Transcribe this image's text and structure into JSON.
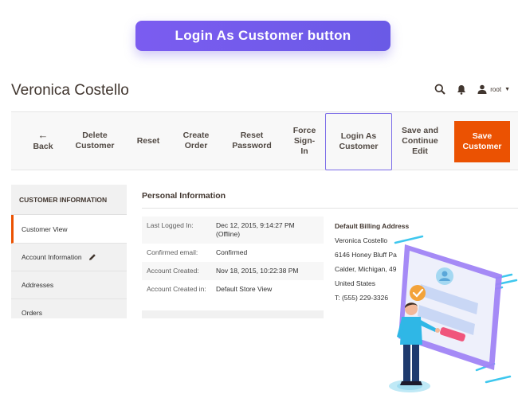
{
  "banner": {
    "label": "Login As Customer button"
  },
  "header": {
    "customer_name": "Veronica Costello",
    "user_label": "root"
  },
  "toolbar": {
    "back": "Back",
    "delete_customer": "Delete\nCustomer",
    "reset": "Reset",
    "create_order": "Create\nOrder",
    "reset_password": "Reset\nPassword",
    "force_sign_in": "Force\nSign-\nIn",
    "login_as_customer": "Login As\nCustomer",
    "save_and_continue": "Save and\nContinue\nEdit",
    "save_customer": "Save\nCustomer"
  },
  "sidebar": {
    "title": "CUSTOMER INFORMATION",
    "items": [
      {
        "label": "Customer View"
      },
      {
        "label": "Account Information"
      },
      {
        "label": "Addresses"
      },
      {
        "label": "Orders"
      }
    ]
  },
  "personal_info": {
    "title": "Personal Information",
    "rows": [
      {
        "label": "Last Logged In:",
        "value": "Dec 12, 2015, 9:14:27 PM (Offline)"
      },
      {
        "label": "Confirmed email:",
        "value": "Confirmed"
      },
      {
        "label": "Account Created:",
        "value": "Nov 18, 2015, 10:22:38 PM"
      },
      {
        "label": "Account Created in:",
        "value": "Default Store View"
      }
    ]
  },
  "billing": {
    "title": "Default Billing Address",
    "lines": [
      "Veronica Costello",
      "6146 Honey Bluff Pa",
      "Calder, Michigan, 49",
      "United States",
      "T: (555) 229-3326"
    ]
  },
  "colors": {
    "accent": "#eb5202",
    "banner": "#7b5cf0",
    "highlight_border": "#7b6ce8"
  },
  "icons": {
    "search": "search-icon",
    "bell": "bell-icon",
    "user": "user-icon",
    "back": "arrow-left-icon",
    "edit": "pencil-icon"
  }
}
